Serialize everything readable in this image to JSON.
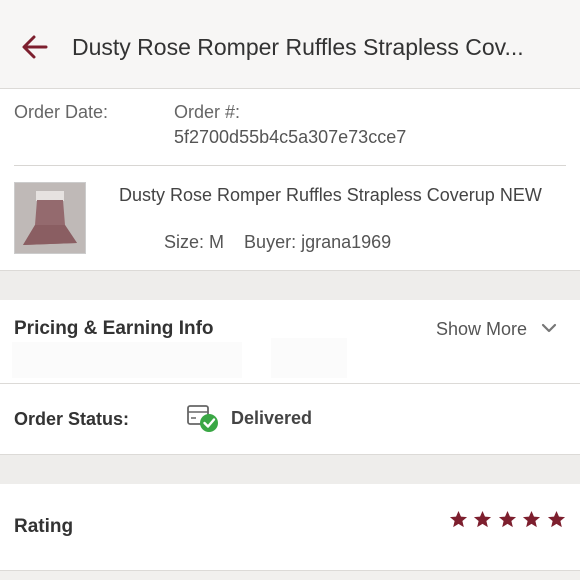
{
  "header": {
    "title": "Dusty Rose Romper Ruffles Strapless Cov...",
    "back_icon": "arrow-left-icon",
    "accent_color": "#7d1f2e"
  },
  "order": {
    "date_label": "Order Date:",
    "number_label": "Order #:",
    "number_value": "5f2700d55b4c5a307e73cce7",
    "item": {
      "title": "Dusty Rose Romper Ruffles Strapless Coverup NEW",
      "size": "Size: M",
      "buyer": "Buyer: jgrana1969"
    }
  },
  "pricing": {
    "title": "Pricing & Earning Info",
    "show_more": "Show More",
    "chevron_icon": "chevron-down-icon"
  },
  "status": {
    "label": "Order Status:",
    "value": "Delivered",
    "icon": "package-delivered-icon",
    "check_color": "#3aa745"
  },
  "rating": {
    "label": "Rating",
    "stars": 5,
    "star_color": "#7d1f2e"
  }
}
